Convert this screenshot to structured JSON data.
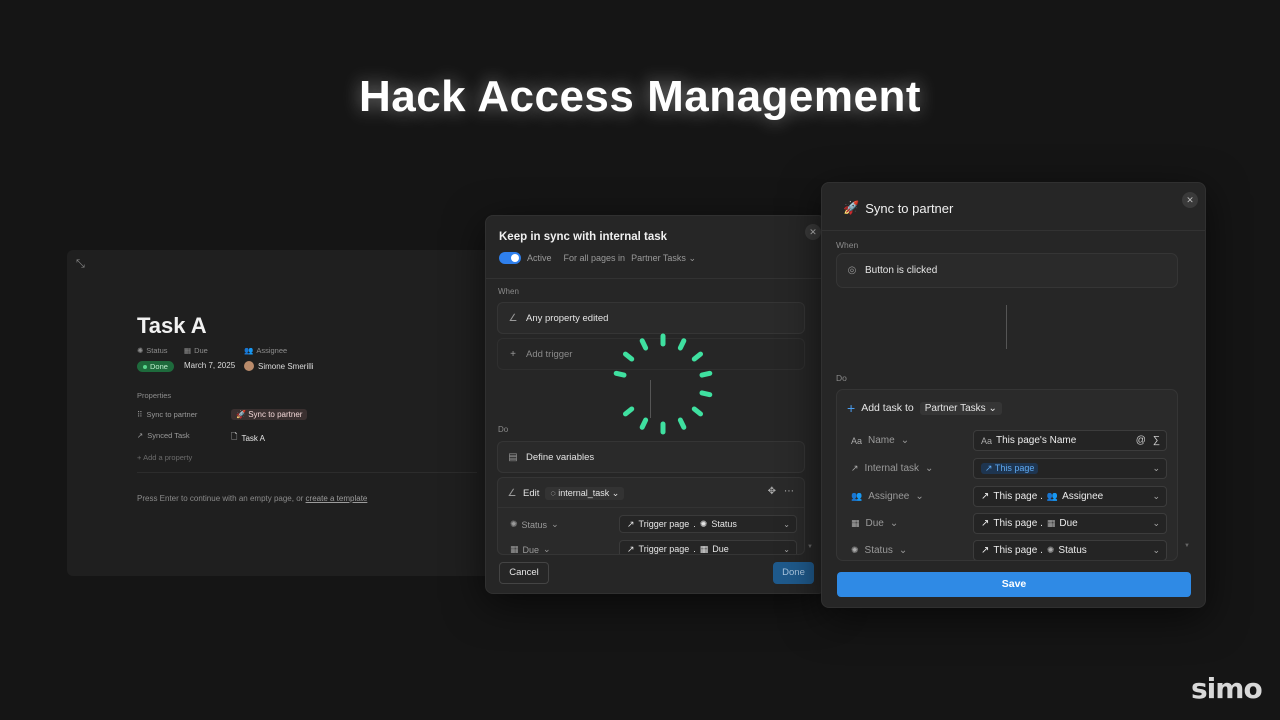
{
  "headline": "Hack Access Management",
  "page": {
    "title": "Task A",
    "properties_header": [
      {
        "name": "Status",
        "icon": "status-icon"
      },
      {
        "name": "Due",
        "icon": "calendar-icon"
      },
      {
        "name": "Assignee",
        "icon": "people-icon"
      }
    ],
    "status_value": "Done",
    "due_value": "March 7, 2025",
    "assignee_value": "Simone Smerilli",
    "section_label": "Properties",
    "rows": [
      {
        "name": "Sync to partner",
        "value": "Sync to partner",
        "emoji": "🚀"
      },
      {
        "name": "Synced Task",
        "value": "Task A"
      }
    ],
    "add_property": "Add a property",
    "hint": "Press Enter to continue with an empty page, or",
    "hint_link": "create a template",
    "status_color": "#1e6a3c"
  },
  "automation_modal": {
    "title": "Keep in sync with internal task",
    "active_label": "Active",
    "scope_label": "For all pages in",
    "scope_db": "Partner Tasks",
    "when_label": "When",
    "trigger": "Any property edited",
    "add_trigger": "Add trigger",
    "do_label": "Do",
    "define_variables": "Define variables",
    "edit_label": "Edit",
    "edit_var": "internal_task",
    "rows": [
      {
        "name": "Status",
        "value_prefix": "Trigger page",
        "value_prop": "Status"
      },
      {
        "name": "Due",
        "value_prefix": "Trigger page",
        "value_prop": "Due"
      }
    ],
    "cancel": "Cancel",
    "done": "Done",
    "accent": "#2f80ed"
  },
  "sync_panel": {
    "title": "Sync to partner",
    "emoji": "🚀",
    "when_label": "When",
    "trigger": "Button is clicked",
    "do_label": "Do",
    "action_label": "Add task to",
    "action_db": "Partner Tasks",
    "fields": [
      {
        "name": "Name",
        "icon": "Aa",
        "value": "This page's Name"
      },
      {
        "name": "Internal task",
        "icon": "↗",
        "value": "This page"
      },
      {
        "name": "Assignee",
        "icon": "👥",
        "value_prefix": "This page .",
        "value_prop": "Assignee"
      },
      {
        "name": "Due",
        "icon": "▦",
        "value_prefix": "This page .",
        "value_prop": "Due"
      },
      {
        "name": "Status",
        "icon": "✺",
        "value_prefix": "This page .",
        "value_prop": "Status"
      }
    ],
    "save": "Save",
    "save_color": "#2f8ae5"
  },
  "spinner_color": "#3fe0a0",
  "logo": "simo"
}
